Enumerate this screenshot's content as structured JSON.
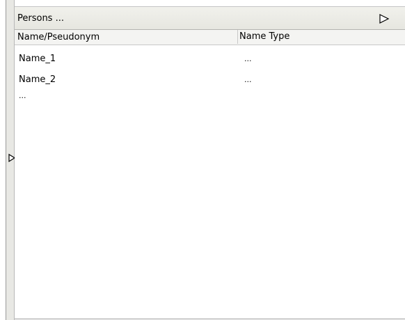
{
  "panel": {
    "title": "Persons ...",
    "columns": [
      "Name/Pseudonym",
      "Name Type"
    ],
    "rows": [
      {
        "name": "Name_1",
        "type": "..."
      },
      {
        "name": "Name_2",
        "type": "..."
      }
    ],
    "more": "..."
  },
  "icons": {
    "title_expander": "triangle-right-icon",
    "left_expander": "triangle-right-icon"
  },
  "colors": {
    "header_bg": "#e6e6e0",
    "strip_bg": "#e8e8e4",
    "border": "#b4b4b0"
  }
}
